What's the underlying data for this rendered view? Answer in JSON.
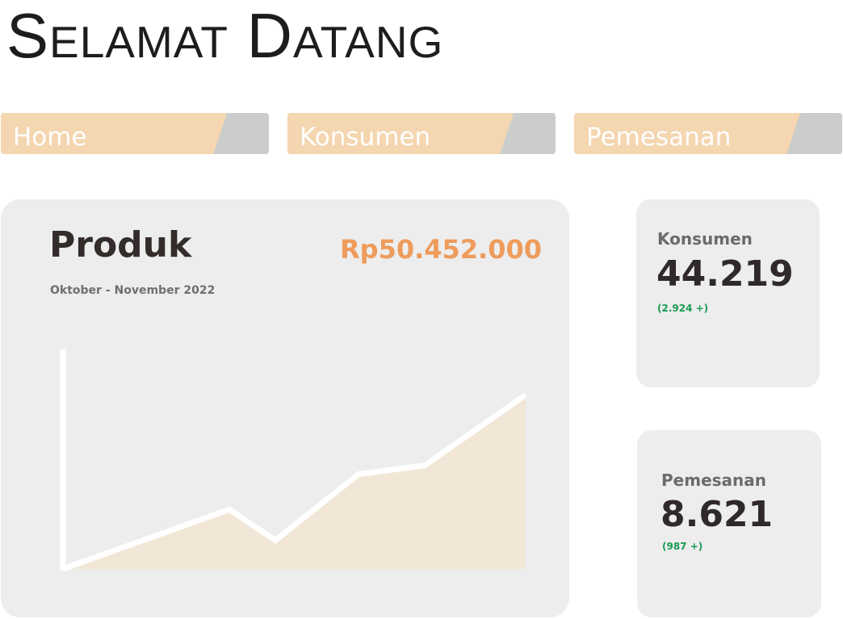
{
  "header": {
    "title": "Selamat Datang"
  },
  "nav": {
    "tabs": [
      {
        "label": "Home"
      },
      {
        "label": "Konsumen"
      },
      {
        "label": "Pemesanan"
      }
    ]
  },
  "produk": {
    "title": "Produk",
    "period": "Oktober - November 2022",
    "total": "Rp50.452.000"
  },
  "stats": {
    "konsumen": {
      "label": "Konsumen",
      "value": "44.219",
      "change": "(2.924 +)"
    },
    "pemesanan": {
      "label": "Pemesanan",
      "value": "8.621",
      "change": "(987 +)"
    }
  },
  "colors": {
    "tab_fill": "#f4d6b0",
    "tab_bg": "#cbcdcc",
    "card_bg": "#ededed",
    "accent_orange": "#ee9b5b",
    "positive_green": "#1a9b54",
    "chart_area": "#f2e6d6",
    "chart_line": "#ffffff"
  },
  "chart_data": {
    "type": "area",
    "x": [
      0,
      1,
      2,
      3,
      4,
      5
    ],
    "values": [
      0,
      27,
      13,
      43,
      47,
      79
    ],
    "ylim": [
      0,
      100
    ],
    "grid": false,
    "legend": "none"
  }
}
